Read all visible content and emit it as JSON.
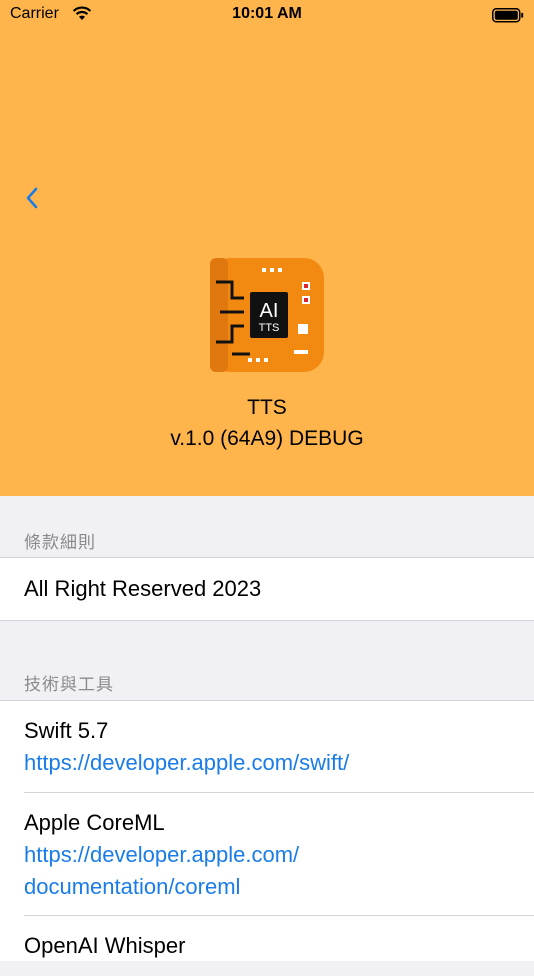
{
  "status_bar": {
    "carrier": "Carrier",
    "time": "10:01 AM"
  },
  "colors": {
    "header_bg": "#FFB54B",
    "link": "#1A7CE8",
    "background": "#F1F1F5"
  },
  "nav": {
    "back_icon": "chevron-left-icon"
  },
  "app": {
    "icon": "ai-chip-icon",
    "icon_text_main": "AI",
    "icon_text_sub": "TTS",
    "name": "TTS",
    "version": "v.1.0 (64A9) DEBUG"
  },
  "sections": [
    {
      "header": "條款細則",
      "cells": [
        {
          "title": "All Right Reserved 2023"
        }
      ]
    },
    {
      "header": "技術與工具",
      "cells": [
        {
          "title": "Swift 5.7",
          "link": "https://developer.apple.com/swift/"
        },
        {
          "title": "Apple CoreML",
          "link_line1": "https://developer.apple.com/",
          "link_line2": "documentation/coreml"
        },
        {
          "title": "OpenAI Whisper"
        }
      ]
    }
  ]
}
